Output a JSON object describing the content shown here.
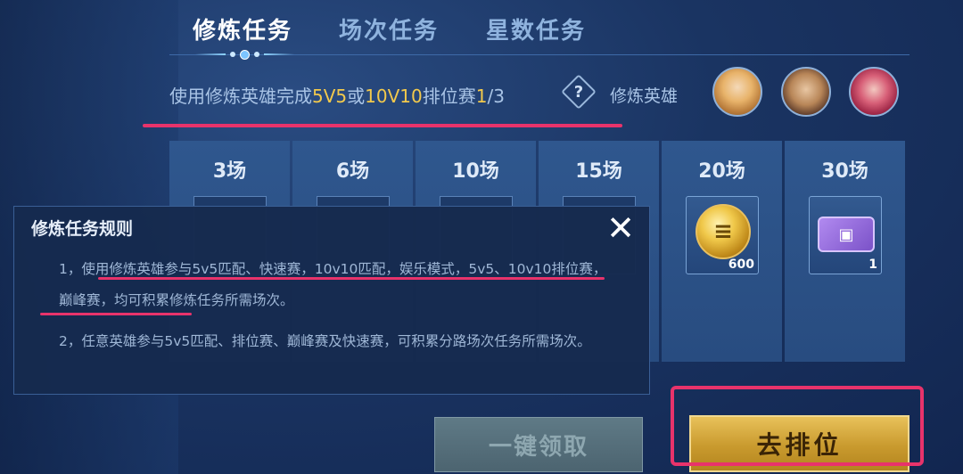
{
  "tabs": [
    {
      "label": "修炼任务",
      "active": true
    },
    {
      "label": "场次任务",
      "active": false
    },
    {
      "label": "星数任务",
      "active": false
    }
  ],
  "task": {
    "prefix": "使用修炼英雄完成",
    "mode1": "5V5",
    "joiner": "或",
    "mode2": "10V10",
    "suffix": "排位赛",
    "progress_current": "1",
    "progress_total": "/3",
    "hero_label": "修炼英雄"
  },
  "milestones": [
    {
      "label": "3场"
    },
    {
      "label": "6场"
    },
    {
      "label": "10场"
    },
    {
      "label": "15场"
    },
    {
      "label": "20场",
      "reward_icon": "coin-scroll-icon",
      "count": "600"
    },
    {
      "label": "30场",
      "reward_icon": "ticket-icon",
      "count": "1"
    }
  ],
  "popup": {
    "title": "修炼任务规则",
    "rule1": "1，使用修炼英雄参与5v5匹配、快速赛，10v10匹配，娱乐模式，5v5、10v10排位赛，巅峰赛，均可积累修炼任务所需场次。",
    "rule2": "2，任意英雄参与5v5匹配、排位赛、巅峰赛及快速赛，可积累分路场次任务所需场次。"
  },
  "buttons": {
    "claim_all": "一键领取",
    "go_ranked": "去排位"
  },
  "colors": {
    "highlight": "#f2c94c",
    "annotation": "#e8336b",
    "primary_button": "#c99a2e"
  }
}
